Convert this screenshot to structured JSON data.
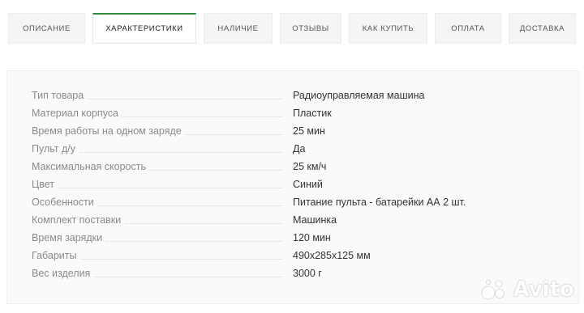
{
  "tabs": [
    {
      "label": "ОПИСАНИЕ",
      "active": false
    },
    {
      "label": "ХАРАКТЕРИСТИКИ",
      "active": true
    },
    {
      "label": "НАЛИЧИЕ",
      "active": false
    },
    {
      "label": "ОТЗЫВЫ",
      "active": false
    },
    {
      "label": "КАК КУПИТЬ",
      "active": false
    },
    {
      "label": "ОПЛАТА",
      "active": false
    },
    {
      "label": "ДОСТАВКА",
      "active": false
    }
  ],
  "specs": [
    {
      "name": "Тип товара",
      "value": "Радиоуправляемая машина"
    },
    {
      "name": "Материал корпуса",
      "value": "Пластик"
    },
    {
      "name": "Время работы на одном заряде",
      "value": "25 мин"
    },
    {
      "name": "Пульт д/у",
      "value": "Да"
    },
    {
      "name": "Максимальная скорость",
      "value": "25 км/ч"
    },
    {
      "name": "Цвет",
      "value": "Синий"
    },
    {
      "name": "Особенности",
      "value": "Питание пульта - батарейки АА 2 шт."
    },
    {
      "name": "Комплект поставки",
      "value": "Машинка"
    },
    {
      "name": "Время зарядки",
      "value": "120 мин"
    },
    {
      "name": "Габариты",
      "value": "490x285x125 мм"
    },
    {
      "name": "Вес изделия",
      "value": "3000 г"
    }
  ],
  "watermark": {
    "text": "Avito",
    "icon": "avito-logo-icon"
  },
  "colors": {
    "accent": "#2e8b3c",
    "tab_bg": "#f5f5f5",
    "panel_bg": "#fafafa"
  }
}
